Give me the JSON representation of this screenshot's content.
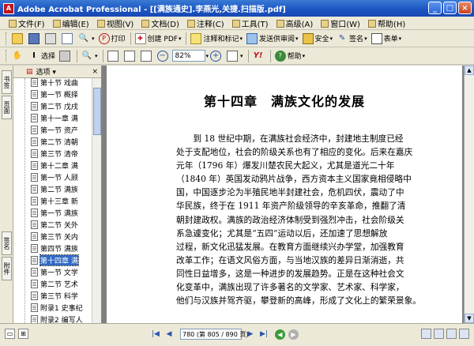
{
  "window": {
    "title": "Adobe Acrobat Professional - [[满族通史].李燕光,关捷.扫描版.pdf]",
    "app_icon": "acrobat-icon",
    "controls": [
      "_",
      "□",
      "×"
    ]
  },
  "menu": [
    {
      "label": "文件(F)"
    },
    {
      "label": "编辑(E)"
    },
    {
      "label": "视图(V)"
    },
    {
      "label": "文档(D)"
    },
    {
      "label": "注释(C)"
    },
    {
      "label": "工具(T)"
    },
    {
      "label": "高级(A)"
    },
    {
      "label": "窗口(W)"
    },
    {
      "label": "帮助(H)"
    }
  ],
  "toolbar1": {
    "create_pdf": "创建 PDF",
    "comment": "注释和标记",
    "send_review": "发送供审阅",
    "security": "安全",
    "sign": "签名",
    "forms": "表单",
    "print_label": "打印"
  },
  "toolbar2": {
    "select": "选择",
    "zoom": "82%",
    "help": "帮助"
  },
  "left_tabs": [
    "书签",
    "页面",
    "签名",
    "附件"
  ],
  "bookmarks": {
    "options": "选项",
    "close": "×",
    "items": [
      {
        "label": "第十节 戏曲"
      },
      {
        "label": "第一节 概择"
      },
      {
        "label": "第二节 戊戌"
      },
      {
        "label": "第十一章 满"
      },
      {
        "label": "第一节 资产"
      },
      {
        "label": "第二节 清朝"
      },
      {
        "label": "第三节 清帝"
      },
      {
        "label": "第十二章 满"
      },
      {
        "label": "第一节 人顾"
      },
      {
        "label": "第二节 满族"
      },
      {
        "label": "第十三章 新"
      },
      {
        "label": "第一节 满族"
      },
      {
        "label": "第二节 关外"
      },
      {
        "label": "第三节 关内"
      },
      {
        "label": "第四节 满族"
      },
      {
        "label": "第十四章 满"
      },
      {
        "label": "第一节 文学"
      },
      {
        "label": "第二节 艺术"
      },
      {
        "label": "第三节 科学"
      },
      {
        "label": "附录1 史事纪"
      },
      {
        "label": "附录2 编写人"
      }
    ],
    "selected_index": 15
  },
  "document": {
    "heading": "第十四章　满族文化的发展",
    "lines": [
      "　　到 18 世纪中期，在满族社会经济中，封建地主制度已经",
      "处于支配地位，社会的阶级关系也有了相应的变化。后来在嘉庆",
      "元年（1796 年）爆发川楚农民大起义，尤其是道光二十年",
      "（1840 年）英国发动鸦片战争，西方资本主义国家竟相侵略中",
      "国，中国逐步沦为半殖民地半封建社会，危机四伏，震动了中",
      "华民族，终于在 1911 年资产阶级领导的辛亥革命，推翻了清",
      "朝封建政权。满族的政治经济体制受到强烈冲击，社会阶级关",
      "系急遽变化；尤其是“五四”运动以后，还加速了思想解放",
      "过程，新文化迅猛发展。在教育方面继续兴办学堂，加强教育",
      "改革工作；在语文风俗方面，与当地汉族的差异日渐消逝，共",
      "同性日益增多，这是一种进步的发展趋势。正是在这种社会文",
      "化变革中，满族出现了许多著名的文学家、艺术家、科学家，",
      "他们与汉族并驾齐驱，攀登新的高峰，形成了文化上的繁荣景象。"
    ]
  },
  "statusbar": {
    "page_display": "780 (第 805 / 890 页)"
  },
  "colors": {
    "titlebar": "#1b56c4",
    "selection": "#316ac5",
    "workspace": "#808080"
  }
}
